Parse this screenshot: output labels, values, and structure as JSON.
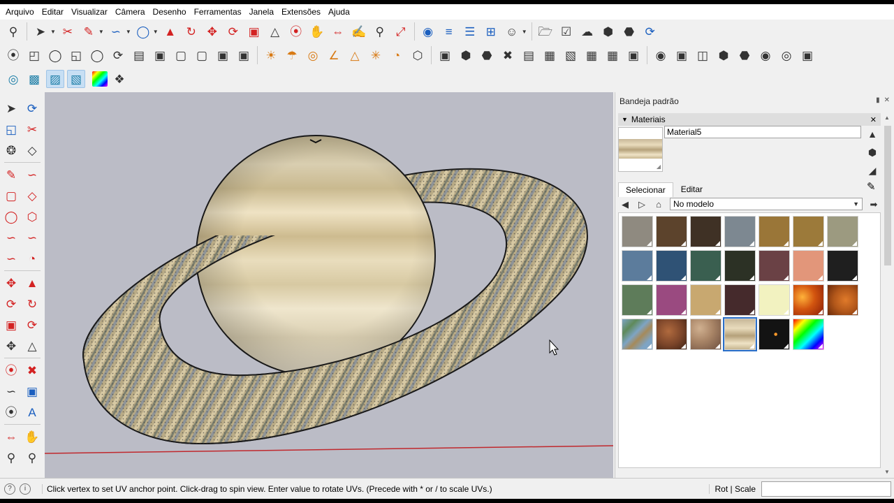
{
  "menu": [
    "Arquivo",
    "Editar",
    "Visualizar",
    "Câmera",
    "Desenho",
    "Ferramentas",
    "Janela",
    "Extensões",
    "Ajuda"
  ],
  "tray": {
    "title": "Bandeja padrão",
    "panel_title": "Materiais",
    "material_name": "Material5",
    "tabs": [
      "Selecionar",
      "Editar"
    ],
    "collection": "No modelo"
  },
  "swatches": [
    {
      "name": "gray-stone",
      "color": "#8f8a80"
    },
    {
      "name": "brown-wood",
      "color": "#5c432c"
    },
    {
      "name": "dark-brown",
      "color": "#3f3125"
    },
    {
      "name": "slate-gray",
      "color": "#7d8891"
    },
    {
      "name": "ochre",
      "color": "#9a7638"
    },
    {
      "name": "ochre-2",
      "color": "#9c7a3a"
    },
    {
      "name": "olive-gray",
      "color": "#9c9a80"
    },
    {
      "name": "steel-blue",
      "color": "#5c7c9c"
    },
    {
      "name": "navy-blue",
      "color": "#2f5275"
    },
    {
      "name": "teal-green",
      "color": "#3a5f50"
    },
    {
      "name": "dark-olive",
      "color": "#2c3125"
    },
    {
      "name": "plum",
      "color": "#6a4145"
    },
    {
      "name": "salmon",
      "color": "#e2967a"
    },
    {
      "name": "near-black",
      "color": "#1f1f1f"
    },
    {
      "name": "sage-green",
      "color": "#5e7c5a"
    },
    {
      "name": "magenta",
      "color": "#9a4a80"
    },
    {
      "name": "tan",
      "color": "#c8a870"
    },
    {
      "name": "maroon",
      "color": "#452a2c"
    },
    {
      "name": "pale-yellow",
      "color": "#f2f2c0"
    },
    {
      "name": "lava-texture",
      "color": "#d2540f"
    },
    {
      "name": "rust-texture",
      "color": "#b2571a"
    },
    {
      "name": "earth-map-texture",
      "color": "#6a8aa5"
    },
    {
      "name": "mars-texture",
      "color": "#7a4429"
    },
    {
      "name": "rock-texture",
      "color": "#a88466"
    },
    {
      "name": "saturn-texture",
      "color": "#d5c6a2"
    },
    {
      "name": "space-texture",
      "color": "#131313"
    },
    {
      "name": "rainbow-texture",
      "color": "#55aaee"
    }
  ],
  "status": {
    "text": "Click vertex to set UV anchor point. Click-drag to spin view.  Enter value to rotate UVs. (Precede with * or / to scale UVs.)",
    "measure_label": "Rot | Scale"
  }
}
